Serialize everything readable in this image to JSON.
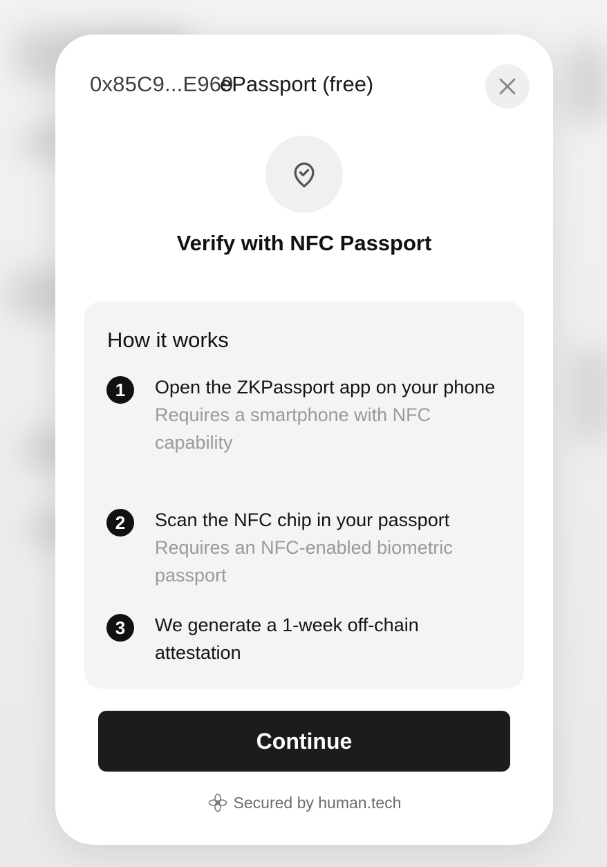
{
  "header": {
    "wallet_address": "0x85C9...E969",
    "mode_label": "ePassport (free)"
  },
  "icons": {
    "close": "close-icon",
    "shield": "shield-check-icon",
    "logo": "human-tech-logo-icon"
  },
  "title": "Verify with NFC Passport",
  "how_it_works": {
    "heading": "How it works",
    "steps": [
      {
        "number": "1",
        "title": "Open the ZKPassport app on your phone",
        "subtitle": "Requires a smartphone with NFC capability"
      },
      {
        "number": "2",
        "title": "Scan the NFC chip in your passport",
        "subtitle": "Requires an NFC-enabled biometric passport"
      },
      {
        "number": "3",
        "title": "We generate a 1-week off-chain attestation",
        "subtitle": ""
      }
    ]
  },
  "actions": {
    "continue_label": "Continue"
  },
  "footer": {
    "secured_label": "Secured by human.tech"
  },
  "colors": {
    "primary_button": "#1c1c1c",
    "card_bg": "#ffffff",
    "panel_bg": "#f4f4f4",
    "muted_text": "#9a9a9a"
  }
}
